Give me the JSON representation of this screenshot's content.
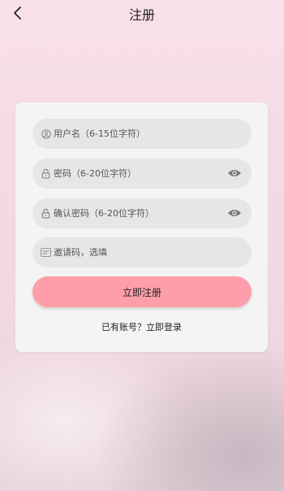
{
  "header": {
    "title": "注册",
    "back_icon": "chevron-left-icon"
  },
  "form": {
    "username": {
      "placeholder": "用户名（6-15位字符）",
      "value": "",
      "icon": "user-icon"
    },
    "password": {
      "placeholder": "密码（6-20位字符）",
      "value": "",
      "icon": "lock-icon",
      "toggle_icon": "eye-icon"
    },
    "confirm_password": {
      "placeholder": "确认密码（6-20位字符）",
      "value": "",
      "icon": "lock-icon",
      "toggle_icon": "eye-icon"
    },
    "invite_code": {
      "placeholder": "邀请码，选填",
      "value": "",
      "icon": "abc-icon"
    },
    "submit_label": "立即注册",
    "login_link": "已有账号？立即登录"
  },
  "colors": {
    "accent": "#fe9eaa",
    "card_bg": "#f4f4f4",
    "field_bg": "#e6e6e6"
  }
}
